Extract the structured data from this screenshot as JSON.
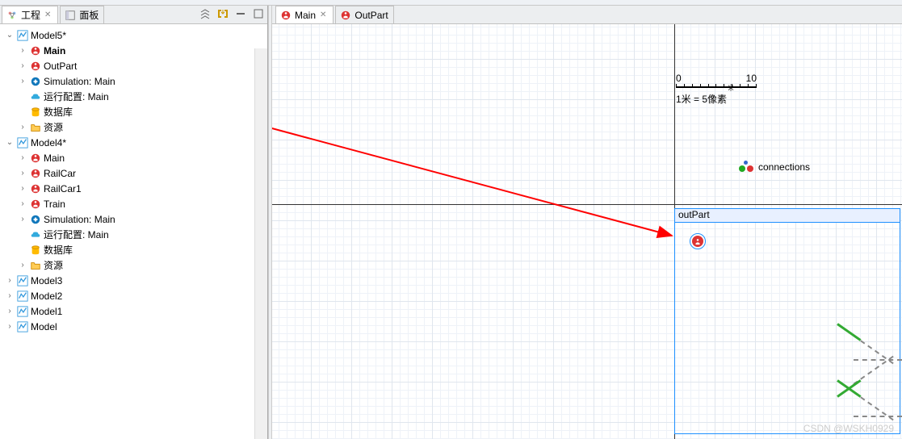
{
  "panel": {
    "tab_project": "工程",
    "tab_panel": "面板"
  },
  "tree": {
    "model5": "Model5*",
    "main_bold": "Main",
    "outpart": "OutPart",
    "sim_main": "Simulation: Main",
    "run_main": "运行配置: Main",
    "database": "数据库",
    "resources": "资源",
    "model4": "Model4*",
    "main": "Main",
    "railcar": "RailCar",
    "railcar1": "RailCar1",
    "train": "Train",
    "model3": "Model3",
    "model2": "Model2",
    "model1": "Model1",
    "model": "Model"
  },
  "editor": {
    "tab_main": "Main",
    "tab_outpart": "OutPart"
  },
  "canvas": {
    "ruler_0": "0",
    "ruler_10": "10",
    "ruler_text": "1米 = 5像素",
    "connections": "connections",
    "agent_header": "outPart"
  },
  "watermark": "CSDN @WSKH0929"
}
